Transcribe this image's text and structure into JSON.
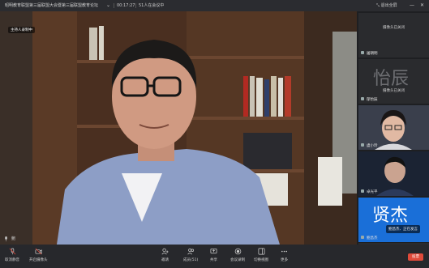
{
  "topbar": {
    "title": "昭明教育联盟第三届联盟大会暨第三届联盟教育论坛",
    "timer": "00:17:27",
    "count": "51人在会议中",
    "exit_fullscreen": "退出全屏",
    "minimize_symbol": "—",
    "close_symbol": "✕"
  },
  "main": {
    "host_tag": "主持人录制中",
    "speaker_name": "鲍昌杰"
  },
  "side": {
    "thumbs": [
      {
        "status": "摄像头已关闭",
        "name": "屠朝明",
        "caption": "",
        "caption_color": "#ffffff"
      },
      {
        "status": "摄像头已关闭",
        "name": "郁怡辰",
        "caption": "怡辰",
        "caption_color": "#6d6e72"
      },
      {
        "status": "",
        "name": "虞小玲",
        "caption": "",
        "caption_color": "#ffffff"
      },
      {
        "status": "",
        "name": "卓光平",
        "caption": "",
        "caption_color": "#ffffff"
      },
      {
        "status": "",
        "name": "鲍昌杰",
        "caption": "贤杰",
        "caption_color": "#ffffff"
      }
    ],
    "speaking_label": "鲍昌杰、正在发言",
    "bottom_peek": "秀丛"
  },
  "toolbar": {
    "items": [
      {
        "label": "取消静音",
        "icon": "mic-muted-icon"
      },
      {
        "label": "开启摄像头",
        "icon": "camera-off-icon"
      },
      {
        "label": "邀请",
        "icon": "invite-icon"
      },
      {
        "label": "成员(51)",
        "icon": "members-icon"
      },
      {
        "label": "共享",
        "icon": "share-icon"
      },
      {
        "label": "会议录制",
        "icon": "record-icon"
      },
      {
        "label": "切换视图",
        "icon": "layout-icon"
      },
      {
        "label": "更多",
        "icon": "more-icon"
      }
    ],
    "leave_label": "投票"
  },
  "colors": {
    "accent_blue": "#1a6fd8",
    "leave_red": "#e04a3a"
  }
}
